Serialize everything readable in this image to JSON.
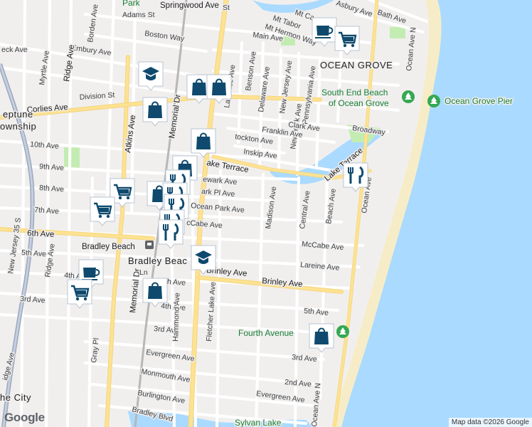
{
  "map": {
    "colors": {
      "land": "#f1efee",
      "water": "#aadaff",
      "park": "#c3ecb2",
      "beach": "#f6edc8",
      "road": "#ffffff",
      "major_road": "#fde293",
      "highway": "#9ca9bd",
      "rail": "#b7b7b7",
      "pin": "#0f4a6e"
    },
    "labels": {
      "park_top": "Park",
      "springwood": "Springwood Ave",
      "adams": "Adams St",
      "borden": "Borden Ave",
      "boston": "Boston Way",
      "deck": "eck Ave",
      "embury": "Embury Ave",
      "myrtle": "Myrtle Ave",
      "ridge_top": "Ridge Ave",
      "division": "Division St",
      "corlies": "Corlies Ave",
      "neptune1": "eptune",
      "neptune2": "ownship",
      "tenth": "10th Ave",
      "ninth": "9th Ave",
      "eighth": "8th Ave",
      "seventh": "7th Ave",
      "sixth": "6th Ave",
      "fifth_w": "5th Ave",
      "fourth_w": "4th Ave",
      "third_w": "3rd Ave",
      "nj35": "New Jersey 35 S",
      "ridge_bot": "Ridge Ave",
      "ridge_edge": "idge Ave",
      "city": "he City",
      "atkins": "Atkins Ave",
      "memorial_top": "Memorial Dr",
      "memorial_bot": "Memorial Dr",
      "gray": "Gray Pl",
      "bradley_beach_station": "Bradley Beach",
      "bradley_beach_town": "Bradley Beac",
      "main": "Main Ave",
      "mt_hermon": "Mt Hermon Way",
      "mt_tabor": "Mt Tabor",
      "mt_ca": "Mt Ca",
      "asbury": "Asbury Ave",
      "bath": "Bath Ave",
      "ocean_grove": "OCEAN GROVE",
      "ocean_ave_n": "Ocean Ave N",
      "benson": "Benson Ave",
      "lawrence": "La rence Ave",
      "delaware": "Delaware Ave",
      "new_jersey_av": "New Jersey Ave",
      "pennsylvania": "Pennsylvania Ave",
      "new_york": "New York Ave",
      "clark": "Clark Ave",
      "franklin": "Franklin Ave",
      "stockton": "tockton Ave",
      "inskip": "Inskip Ave",
      "broadway": "Broadway",
      "south_end_beach_1": "South End Beach",
      "south_end_beach_2": "of Ocean Grove",
      "ocean_grove_pier": "Ocean Grove Pier",
      "lake_terrace_w": "ake Terrace",
      "lake_terrace_e": "Lake Terrace",
      "newark": "ewark Ave",
      "park_pl": "ark Pl Ave",
      "ocean_park": "Ocean Park Ave",
      "mccabe_w": "cCabe Ave",
      "mccabe_e": "McCabe Ave",
      "madison": "Madison Ave",
      "central": "Central Ave",
      "beach_ave": "Beach Ave",
      "ocean_ave": "Ocean Ave",
      "lareine": "Lareine Ave",
      "brinley_w": "Brinley Ave",
      "brinley_e": "Brinley Ave",
      "fifth_c": "5th Ave",
      "fifth_e": "5th Ave",
      "fourth_c": "4th Ave",
      "third_c": "3rd Ave",
      "third_e": "3rd Ave",
      "second_e": "2nd Ave",
      "hammond": "Hammond Ave",
      "fletcher_lake": "Fletcher Lake Ave",
      "fourth_avenue_beach": "Fourth Avenue",
      "evergreen_w": "Evergreen Ave",
      "evergreen_e": "Evergreen Ave",
      "monmouth": "Monmouth Ave",
      "burlington": "Burlington Ave",
      "bradley_blvd": "Bradley Blvd",
      "sylvan_lake": "Sylvan Lake",
      "ocean_ave_bottom": "Ocean Ave N",
      "st_fragment": "St",
      "ln_fragment": "Ln"
    },
    "google_logo": "Google",
    "attribution": "Map data ©2026 Google",
    "pins": [
      {
        "icon": "cafe-icon"
      },
      {
        "icon": "shopping-cart-icon"
      },
      {
        "icon": "school-icon"
      },
      {
        "icon": "shopping-bag-icon"
      },
      {
        "icon": "shopping-bag-icon"
      },
      {
        "icon": "shopping-bag-icon"
      },
      {
        "icon": "shopping-bag-icon"
      },
      {
        "icon": "shopping-bag-icon"
      },
      {
        "icon": "restaurant-icon"
      },
      {
        "icon": "shopping-cart-icon"
      },
      {
        "icon": "shopping-cart-icon"
      },
      {
        "icon": "shopping-bag-icon"
      },
      {
        "icon": "restaurant-icon"
      },
      {
        "icon": "restaurant-icon"
      },
      {
        "icon": "restaurant-icon"
      },
      {
        "icon": "restaurant-icon"
      },
      {
        "icon": "school-icon"
      },
      {
        "icon": "cafe-icon"
      },
      {
        "icon": "shopping-cart-icon"
      },
      {
        "icon": "shopping-bag-icon"
      },
      {
        "icon": "shopping-bag-icon"
      },
      {
        "icon": "restaurant-icon"
      }
    ]
  }
}
